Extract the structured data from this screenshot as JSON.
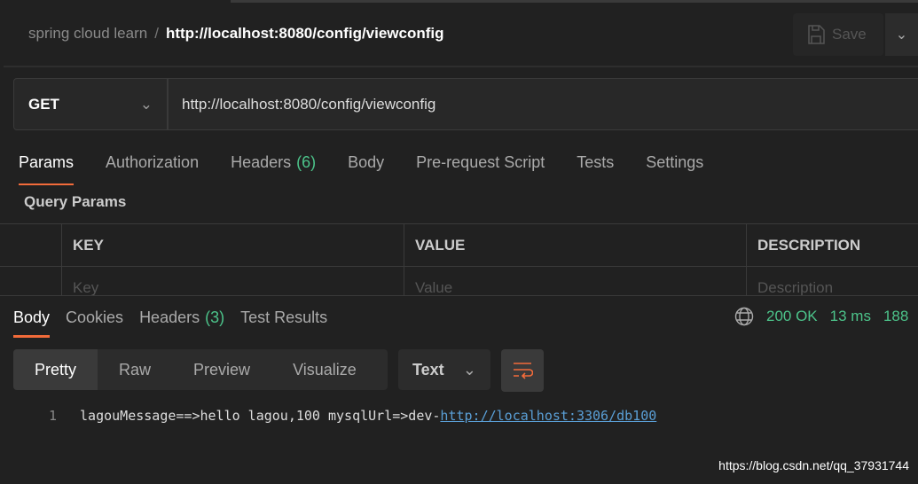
{
  "header": {
    "collection": "spring cloud learn",
    "separator": "/",
    "request_name": "http://localhost:8080/config/viewconfig",
    "save_label": "Save"
  },
  "request": {
    "method": "GET",
    "url": "http://localhost:8080/config/viewconfig"
  },
  "request_tabs": [
    {
      "label": "Params",
      "active": true
    },
    {
      "label": "Authorization"
    },
    {
      "label": "Headers",
      "count": "(6)"
    },
    {
      "label": "Body"
    },
    {
      "label": "Pre-request Script"
    },
    {
      "label": "Tests"
    },
    {
      "label": "Settings"
    }
  ],
  "params": {
    "title": "Query Params",
    "columns": [
      "KEY",
      "VALUE",
      "DESCRIPTION"
    ],
    "placeholders": [
      "Key",
      "Value",
      "Description"
    ]
  },
  "response_tabs": [
    {
      "label": "Body",
      "active": true
    },
    {
      "label": "Cookies"
    },
    {
      "label": "Headers",
      "count": "(3)"
    },
    {
      "label": "Test Results"
    }
  ],
  "status": {
    "code": "200 OK",
    "time": "13 ms",
    "size": "188",
    "color": "#4cc38a"
  },
  "view_modes": [
    "Pretty",
    "Raw",
    "Preview",
    "Visualize"
  ],
  "format": "Text",
  "body": {
    "line": "1",
    "text": "lagouMessage==>hello lagou,100 mysqlUrl=>dev-",
    "link": "http://localhost:3306/db100"
  },
  "watermark": "https://blog.csdn.net/qq_37931744",
  "accent": "#f26b3a"
}
